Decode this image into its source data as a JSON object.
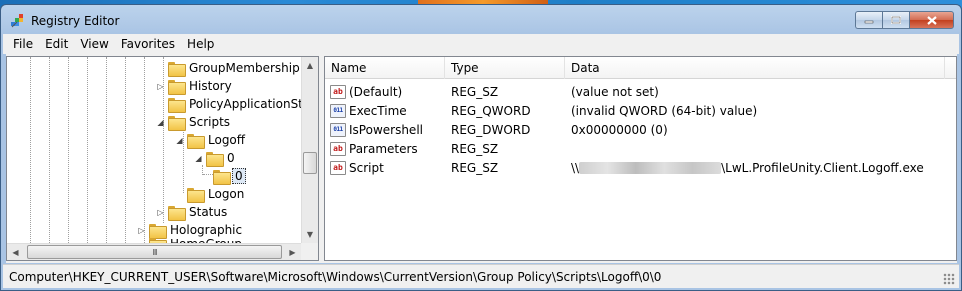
{
  "window": {
    "title": "Registry Editor"
  },
  "menu": [
    "File",
    "Edit",
    "View",
    "Favorites",
    "Help"
  ],
  "tree": {
    "items": [
      {
        "label": "GroupMembership",
        "expander": ""
      },
      {
        "label": "History",
        "expander": "▷"
      },
      {
        "label": "PolicyApplicationStat",
        "expander": ""
      },
      {
        "label": "Scripts",
        "expander": "◢"
      },
      {
        "label": "Logoff",
        "expander": "◢"
      },
      {
        "label": "0",
        "expander": "◢"
      },
      {
        "label": "0",
        "expander": "",
        "selected": true
      },
      {
        "label": "Logon",
        "expander": ""
      },
      {
        "label": "Status",
        "expander": "▷"
      },
      {
        "label": "Holographic",
        "expander": "▷"
      },
      {
        "label": "HomeGroup",
        "expander": ""
      }
    ],
    "hscroll_grip": "III"
  },
  "list": {
    "columns": [
      "Name",
      "Type",
      "Data"
    ],
    "rows": [
      {
        "icon": "string-value-icon",
        "icon_text": "ab",
        "name": "(Default)",
        "type": "REG_SZ",
        "data": "(value not set)"
      },
      {
        "icon": "binary-value-icon",
        "icon_text": "011\n110",
        "name": "ExecTime",
        "type": "REG_QWORD",
        "data": "(invalid QWORD (64-bit) value)"
      },
      {
        "icon": "binary-value-icon",
        "icon_text": "011\n110",
        "name": "IsPowershell",
        "type": "REG_DWORD",
        "data": "0x00000000 (0)"
      },
      {
        "icon": "string-value-icon",
        "icon_text": "ab",
        "name": "Parameters",
        "type": "REG_SZ",
        "data": ""
      },
      {
        "icon": "string-value-icon",
        "icon_text": "ab",
        "name": "Script",
        "type": "REG_SZ",
        "data_prefix": "\\\\",
        "data_suffix": "\\LwL.ProfileUnity.Client.Logoff.exe"
      }
    ]
  },
  "status": {
    "path": "Computer\\HKEY_CURRENT_USER\\Software\\Microsoft\\Windows\\CurrentVersion\\Group Policy\\Scripts\\Logoff\\0\\0"
  },
  "colors": {
    "titlebar": "#a9c4e4",
    "close_button": "#c3401e",
    "selection": "#dde8f5"
  }
}
